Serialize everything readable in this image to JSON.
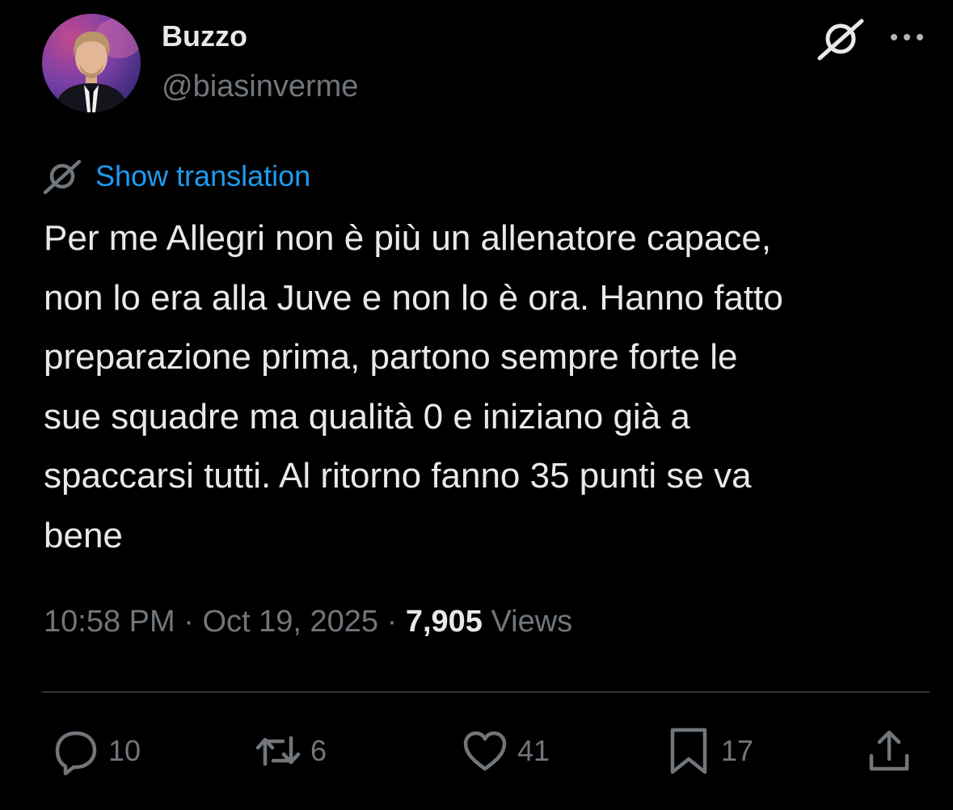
{
  "author": {
    "display_name": "Buzzo",
    "handle": "@biasinverme"
  },
  "header_icons": {
    "grok": "grok-icon",
    "more": "more-icon"
  },
  "translation": {
    "icon": "grok-icon",
    "label": "Show translation"
  },
  "tweet": {
    "text": "Per me Allegri non è più un allenatore capace,\nnon lo era alla Juve e non lo è ora. Hanno fatto\npreparazione prima, partono sempre forte le\nsue squadre ma qualità 0 e iniziano già a\nspaccarsi tutti. Al ritorno fanno 35 punti se va\nbene"
  },
  "meta": {
    "time": "10:58 PM",
    "separator": " · ",
    "date": "Oct 19, 2025",
    "views_count": "7,905",
    "views_label": " Views"
  },
  "actions": {
    "replies": "10",
    "reposts": "6",
    "likes": "41",
    "bookmarks": "17"
  },
  "colors": {
    "background": "#000000",
    "text": "#e7e9ea",
    "muted": "#71767b",
    "link": "#1d9bf0",
    "divider": "#2f3336"
  }
}
